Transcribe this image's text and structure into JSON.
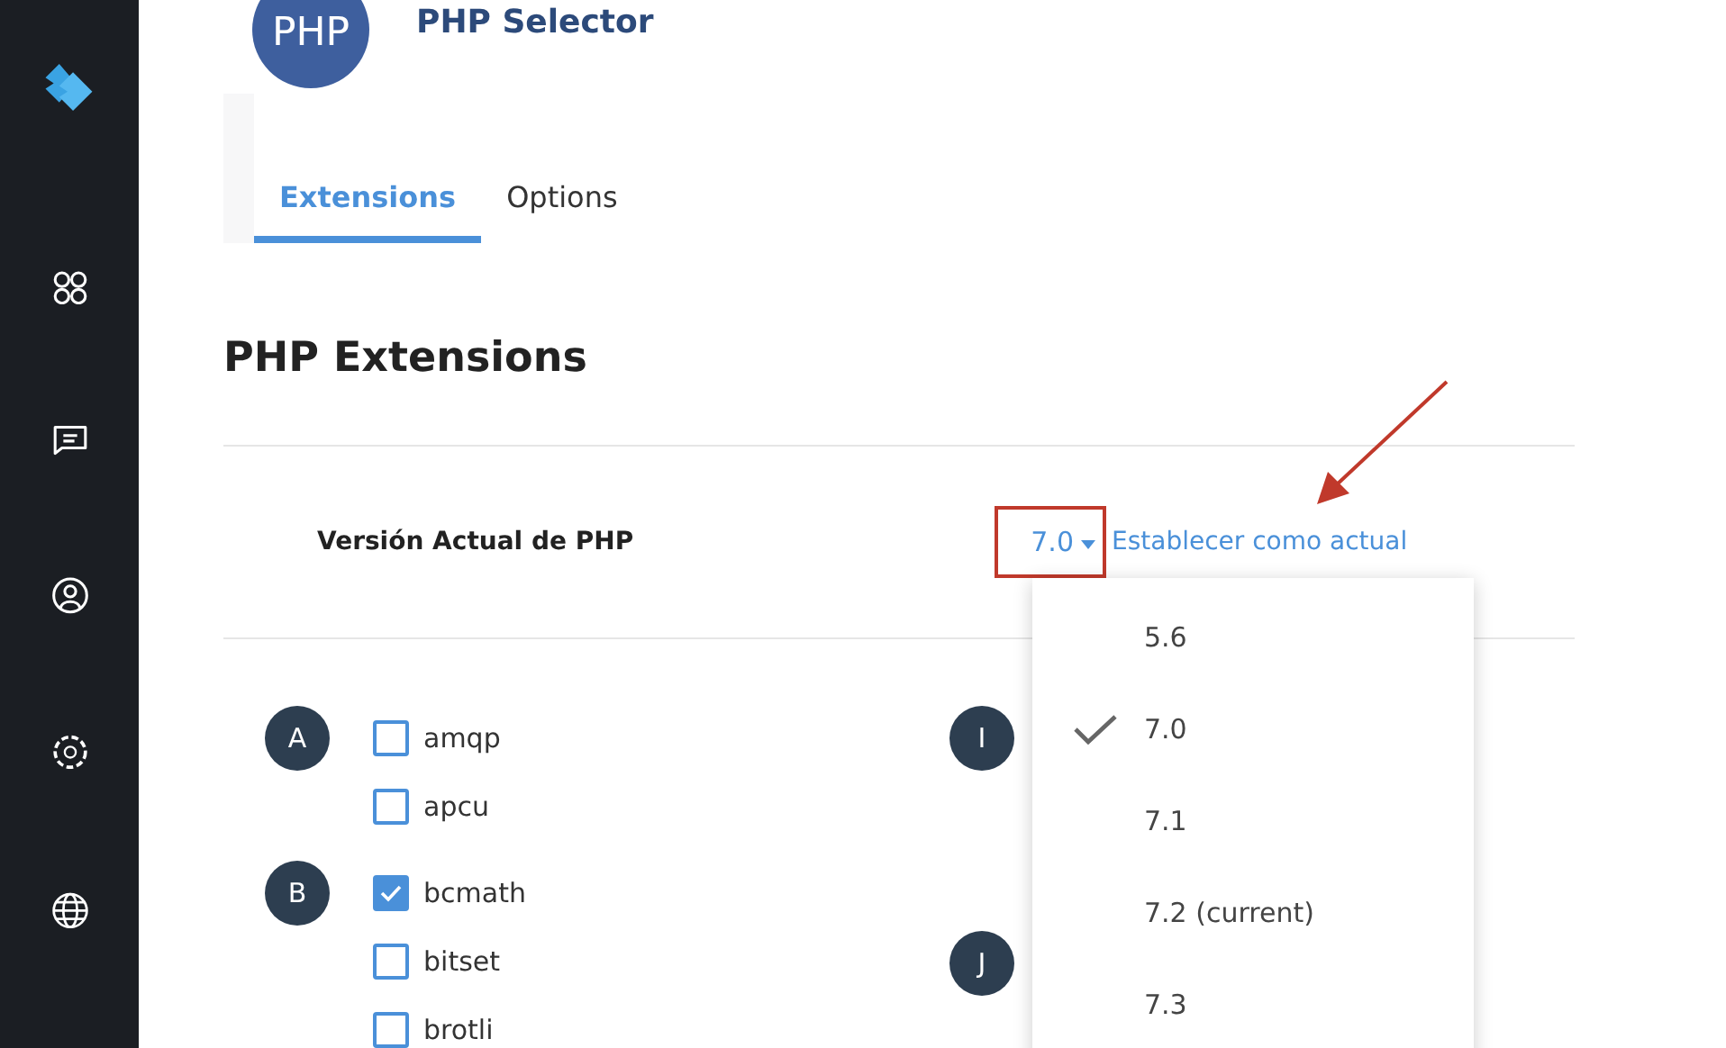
{
  "header": {
    "logo_text": "PHP",
    "title": "PHP Selector"
  },
  "tabs": [
    {
      "label": "Extensions",
      "selected": true
    },
    {
      "label": "Options",
      "selected": false
    }
  ],
  "section_title": "PHP Extensions",
  "version_row": {
    "label": "Versión Actual de PHP",
    "value": "7.0",
    "link": "Establecer como actual",
    "highlighted": true,
    "options": [
      {
        "label": "5.6",
        "selected": false
      },
      {
        "label": "7.0",
        "selected": true
      },
      {
        "label": "7.1",
        "selected": false
      },
      {
        "label": "7.2 (current)",
        "selected": false
      },
      {
        "label": "7.3",
        "selected": false
      }
    ]
  },
  "columns": [
    [
      {
        "letter": "A",
        "extensions": [
          {
            "name": "amqp",
            "checked": false
          },
          {
            "name": "apcu",
            "checked": false
          }
        ]
      },
      {
        "letter": "B",
        "extensions": [
          {
            "name": "bcmath",
            "checked": true
          },
          {
            "name": "bitset",
            "checked": false
          },
          {
            "name": "brotli",
            "checked": false
          }
        ]
      }
    ],
    [
      {
        "letter": "I"
      },
      {
        "letter": "J"
      }
    ]
  ]
}
